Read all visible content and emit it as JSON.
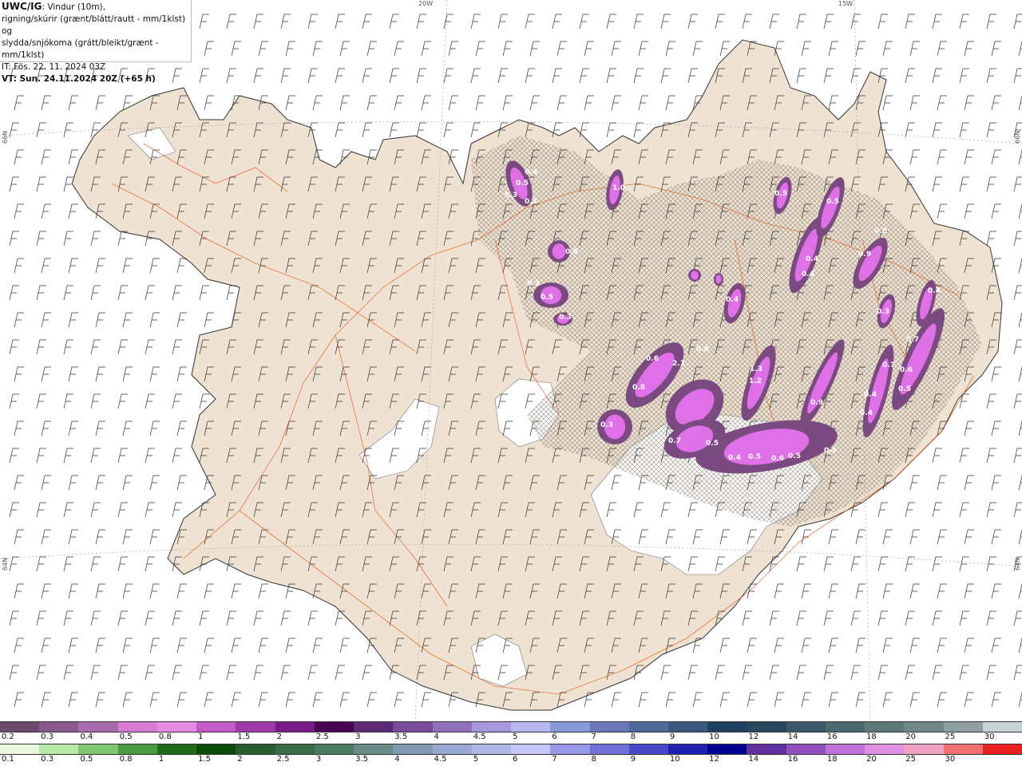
{
  "header": {
    "code": "UWC/IG",
    "line1_suffix": ": Vindur (10m),",
    "line2": "rigning/skúrir (grænt/blátt/rautt - mm/1klst) og",
    "line3": "slydda/snjókoma (grátt/bleikt/grænt - mm/1klst)",
    "line4": "IT: Fös. 22. 11. 2024 03Z",
    "line5": "VT: Sun. 24.11.2024 20Z (+65 h)"
  },
  "grid_labels": {
    "lon_20w": "20W",
    "lon_15w": "15W",
    "lat_66n_left": "66N",
    "lat_66n_right": "66N",
    "lat_64n_left": "64N",
    "lat_64n_right": "64N"
  },
  "precip_labels": [
    "0.4",
    "0.5",
    "0.3",
    "0.3",
    "1.0",
    "0.6",
    "0.5",
    "0.3",
    "0.3",
    "0.5",
    "0.5",
    "0.4",
    "0.4",
    "0.8",
    "0.9",
    "0.4",
    "0.3",
    "0.4",
    "0.7",
    "0.6",
    "0.7",
    "0.5",
    "0.4",
    "0.4",
    "0.9",
    "0.8",
    "2.1",
    "0.8",
    "0.6",
    "1.3",
    "1.2",
    "0.7",
    "0.5",
    "0.4",
    "0.5",
    "0.6",
    "0.5",
    "0.9",
    "0.3"
  ],
  "legend_top": {
    "labels": [
      "0.2",
      "0.3",
      "0.4",
      "0.5",
      "0.8",
      "1",
      "1.5",
      "2",
      "2.5",
      "3",
      "3.5",
      "4",
      "4.5",
      "5",
      "6",
      "7",
      "8",
      "9",
      "10",
      "12",
      "14",
      "16",
      "18",
      "20",
      "25",
      "30"
    ],
    "colors": [
      "#6b4a6e",
      "#8a5a8f",
      "#a96aae",
      "#d67ad6",
      "#e58ae5",
      "#c45ac8",
      "#a03aa8",
      "#7a1a88",
      "#4a0050",
      "#5e2a78",
      "#7a4a9c",
      "#9070bc",
      "#a898dc",
      "#b8b8f0",
      "#8898d8",
      "#6a78b8",
      "#50689c",
      "#385880",
      "#1e4060",
      "#284860",
      "#3a5868",
      "#4c6870",
      "#5e7878",
      "#708888",
      "#90a0a0",
      "#c8d4d4"
    ]
  },
  "legend_bottom": {
    "labels": [
      "0.1",
      "0.3",
      "0.5",
      "0.8",
      "1",
      "1.5",
      "2",
      "2.5",
      "3",
      "3.5",
      "4",
      "4.5",
      "5",
      "6",
      "7",
      "8",
      "9",
      "10",
      "12",
      "14",
      "16",
      "18",
      "20",
      "25",
      "30"
    ],
    "colors": [
      "#e8f8e0",
      "#b8e8a8",
      "#80c870",
      "#4a9a40",
      "#1e6a18",
      "#0a4a08",
      "#2a5a30",
      "#3a6a48",
      "#4a7a60",
      "#6a8a88",
      "#8098b0",
      "#98a8d0",
      "#b0b8e8",
      "#c8c8f8",
      "#9898e8",
      "#7070d8",
      "#4848c8",
      "#2020b0",
      "#000090",
      "#6030a0",
      "#9050c0",
      "#c070d8",
      "#e090e0",
      "#f0a0c0",
      "#f07070",
      "#e82020"
    ]
  }
}
